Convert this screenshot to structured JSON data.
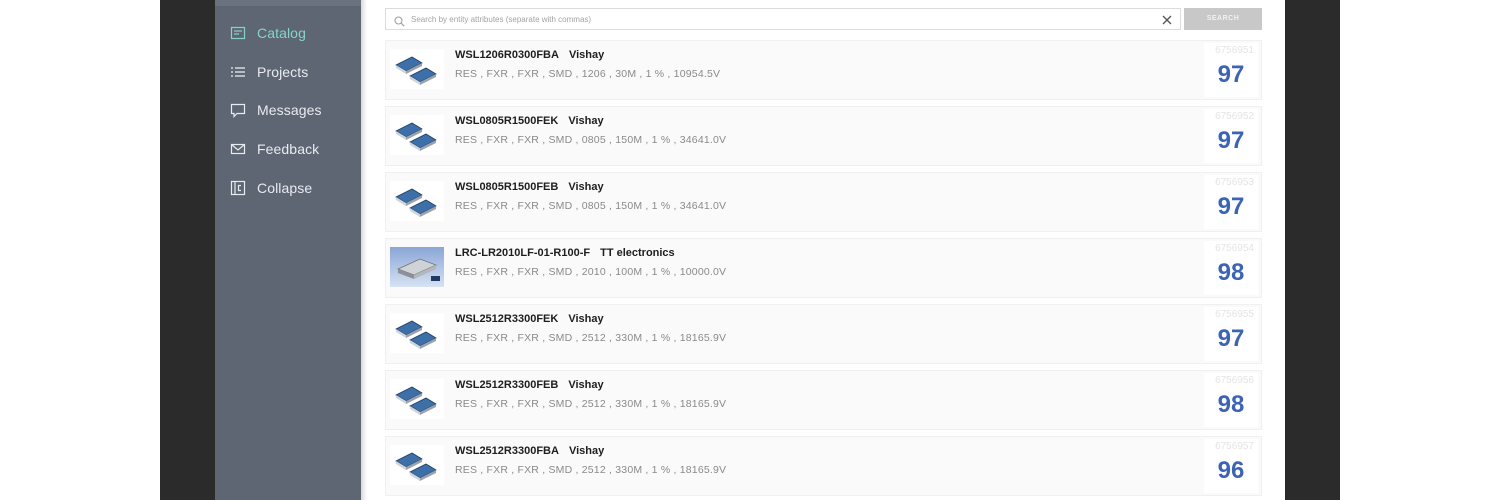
{
  "sidebar": {
    "items": [
      {
        "label": "Catalog",
        "icon": "catalog-icon",
        "active": true
      },
      {
        "label": "Projects",
        "icon": "list-icon",
        "active": false
      },
      {
        "label": "Messages",
        "icon": "message-icon",
        "active": false
      },
      {
        "label": "Feedback",
        "icon": "mail-icon",
        "active": false
      },
      {
        "label": "Collapse",
        "icon": "collapse-icon",
        "active": false
      }
    ]
  },
  "search": {
    "placeholder": "Search by entity attributes (separate with commas)",
    "button_label": "SEARCH"
  },
  "colors": {
    "sidebar_bg": "#5e6674",
    "active_accent": "#86d3cc",
    "score_color": "#3c64b4",
    "frame": "#2b2b2b"
  },
  "results": [
    {
      "part": "WSL1206R0300FBA",
      "manufacturer": "Vishay",
      "desc": "RES , FXR , FXR , SMD , 1206 , 30M , 1 % , 10954.5V",
      "id": "6756951",
      "score": "97",
      "thumb": "chip-resistor-pair"
    },
    {
      "part": "WSL0805R1500FEK",
      "manufacturer": "Vishay",
      "desc": "RES , FXR , FXR , SMD , 0805 , 150M , 1 % , 34641.0V",
      "id": "6756952",
      "score": "97",
      "thumb": "chip-resistor-pair"
    },
    {
      "part": "WSL0805R1500FEB",
      "manufacturer": "Vishay",
      "desc": "RES , FXR , FXR , SMD , 0805 , 150M , 1 % , 34641.0V",
      "id": "6756953",
      "score": "97",
      "thumb": "chip-resistor-pair"
    },
    {
      "part": "LRC-LR2010LF-01-R100-F",
      "manufacturer": "TT electronics",
      "desc": "RES , FXR , FXR , SMD , 2010 , 100M , 1 % , 10000.0V",
      "id": "6756954",
      "score": "98",
      "thumb": "metal-resistor"
    },
    {
      "part": "WSL2512R3300FEK",
      "manufacturer": "Vishay",
      "desc": "RES , FXR , FXR , SMD , 2512 , 330M , 1 % , 18165.9V",
      "id": "6756955",
      "score": "97",
      "thumb": "chip-resistor-pair"
    },
    {
      "part": "WSL2512R3300FEB",
      "manufacturer": "Vishay",
      "desc": "RES , FXR , FXR , SMD , 2512 , 330M , 1 % , 18165.9V",
      "id": "6756956",
      "score": "98",
      "thumb": "chip-resistor-pair"
    },
    {
      "part": "WSL2512R3300FBA",
      "manufacturer": "Vishay",
      "desc": "RES , FXR , FXR , SMD , 2512 , 330M , 1 % , 18165.9V",
      "id": "6756957",
      "score": "96",
      "thumb": "chip-resistor-pair"
    }
  ]
}
